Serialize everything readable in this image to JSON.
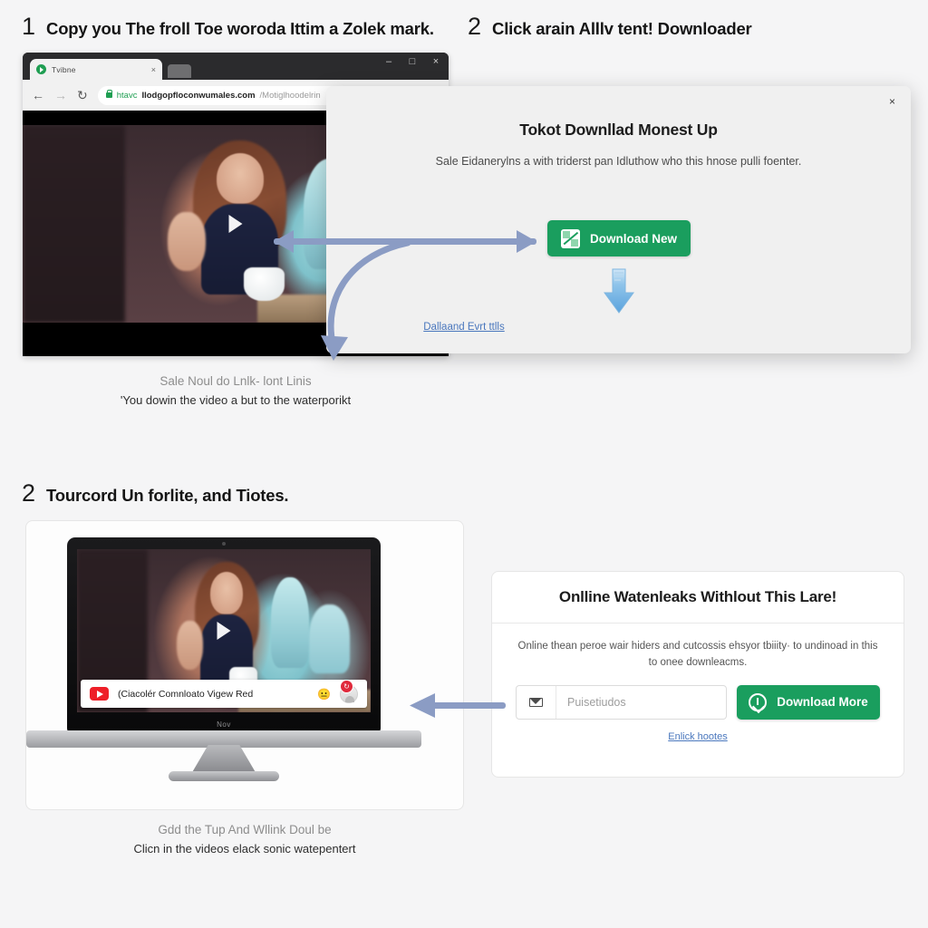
{
  "steps": [
    {
      "number": "1",
      "title": "Copy you The froll Toe woroda Ittim a Zolek mark."
    },
    {
      "number": "2",
      "title": "Click arain Alllv tent! Downloader"
    },
    {
      "number": "2",
      "title": "Tourcord Un forlite, and Tiotes."
    }
  ],
  "browser": {
    "tab_title": "Tvibne",
    "tab_close": "×",
    "new_tab_icon": "new-tab",
    "window_minimize": "–",
    "window_maximize": "□",
    "window_close": "×",
    "back_icon": "←",
    "forward_icon": "→",
    "reload_icon": "↻",
    "url_scheme": "htavc",
    "url_host": "Ilodgopfloconwumales.com",
    "url_path": "/Motiglhoodelrin",
    "play_icon": "play-triangle"
  },
  "modal": {
    "close_label": "×",
    "title": "Tokot Downllad Monest Up",
    "body": "Sale Eidanerylns a with triderst pan Idluthow who this hnose pulli foenter.",
    "button_label": "Download New",
    "button_color": "#1a9e5e",
    "arrow_icon": "download-arrow",
    "link_label": "Dallaand Evrt ttlls"
  },
  "captions": {
    "top_muted": "Sale Noul do Lnlk- lont Linis",
    "top_dark": "'You dowin the video a but to the waterporikt",
    "bottom_muted": "Gdd the Tup And Wllink Doul be",
    "bottom_dark": "Clicn in the videos elack sonic watepentert"
  },
  "monitor": {
    "brand_label": "Nov",
    "notification": {
      "source_icon": "youtube-icon",
      "text": "(Ciacolér Comnloato Vigew Red",
      "emoji": "😐",
      "avatar_icon": "user-avatar",
      "badge": "↻"
    }
  },
  "card": {
    "title": "Onlline Watenleaks Withlout This Lare!",
    "description": "Online thean peroe wair hiders and cutcossis ehsyor tbiiity· to undinoad in this to onee downleacms.",
    "input_icon": "envelope-icon",
    "input_placeholder": "Puisetiudos",
    "input_value": "",
    "button_label": "Download More",
    "button_icon": "download-circle-icon",
    "button_color": "#1a9e5e",
    "link_label": "Enlick hootes"
  },
  "annotations": {
    "arrow_color": "#8b9cc4",
    "arrow_1": "double-headed-arrow-video-to-button",
    "arrow_2": "curved-arrow-to-caption",
    "arrow_3": "left-arrow-card-to-notification"
  }
}
